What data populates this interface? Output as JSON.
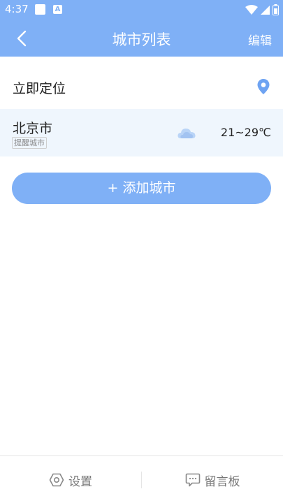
{
  "status": {
    "time": "4:37",
    "a_icon_letter": "A"
  },
  "header": {
    "title": "城市列表",
    "edit_label": "编辑"
  },
  "locate": {
    "label": "立即定位"
  },
  "city": {
    "name": "北京市",
    "tag": "提醒城市",
    "weather_icon": "cloud-icon",
    "temperature": "21~29℃"
  },
  "add_city": {
    "label": "+ 添加城市"
  },
  "bottom_nav": {
    "settings_label": "设置",
    "message_label": "留言板"
  },
  "colors": {
    "primary": "#7fb0f6",
    "row_bg": "#eff6fd",
    "text": "#222222"
  }
}
